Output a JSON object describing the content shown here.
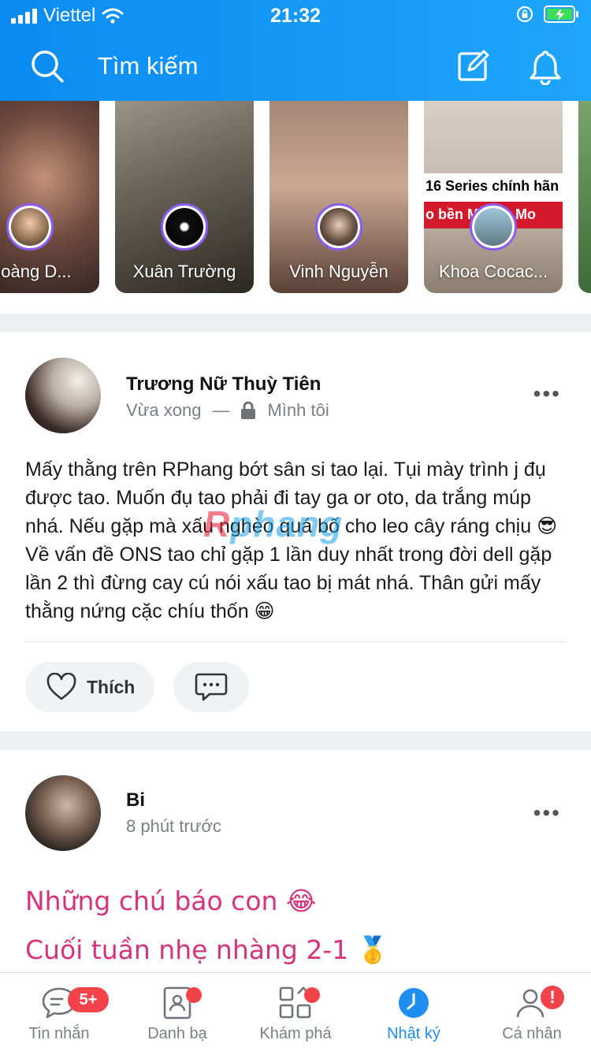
{
  "status_bar": {
    "carrier": "Viettel",
    "time": "21:32"
  },
  "header": {
    "search_placeholder": "Tìm kiếm",
    "colors": {
      "accent": "#1a9bf7"
    }
  },
  "stories": [
    {
      "name": "Hoàng D..."
    },
    {
      "name": "Xuân Trường"
    },
    {
      "name": "Vinh Nguyễn"
    },
    {
      "name": "Khoa Cocac...",
      "banner_line1": "16 Series chính hãn",
      "banner_line2": "o bền M... ẩn Mo"
    }
  ],
  "posts": [
    {
      "author": "Trương Nữ Thuỳ Tiên",
      "time": "Vừa xong",
      "separator": "—",
      "privacy": "Mình tôi",
      "text": "Mấy thằng trên RPhang bớt sân si tao lại. Tụi mày trình j đụ được tao. Muốn đụ tao phải đi tay ga or oto, da trắng múp nhá. Nếu gặp mà xấu nghèo quá bố cho leo cây ráng chịu 😎 Về vấn đề ONS tao chỉ gặp 1 lần duy nhất trong đời dell gặp lần 2 thì đừng cay cú nói xấu tao bị mát nhá. Thân gửi mấy thằng nứng cặc chíu thốn 😁",
      "like_label": "Thích"
    },
    {
      "author": "Bi",
      "time": "8 phút trước",
      "lines": [
        "Những chú báo con 😂",
        "Cuối tuần nhẹ nhàng 2-1 🥇"
      ]
    }
  ],
  "watermark": {
    "part1": "R",
    "part2": "phang"
  },
  "tabbar": {
    "items": [
      {
        "label": "Tin nhắn",
        "badge": "5+"
      },
      {
        "label": "Danh bạ"
      },
      {
        "label": "Khám phá"
      },
      {
        "label": "Nhật ký"
      },
      {
        "label": "Cá nhân",
        "badge": "!"
      }
    ],
    "active_index": 3
  }
}
